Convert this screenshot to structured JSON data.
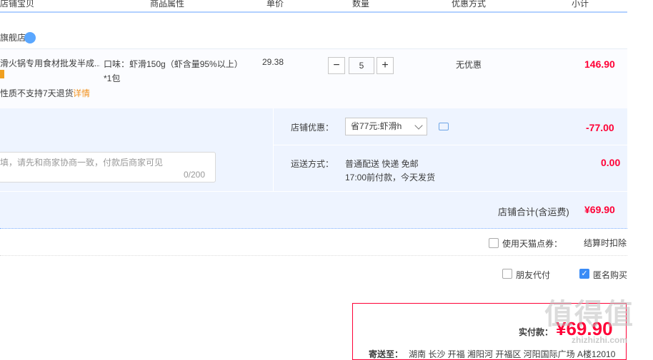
{
  "header": {
    "cols": [
      "店铺宝贝",
      "商品属性",
      "单价",
      "数量",
      "优惠方式",
      "小计"
    ]
  },
  "shop": {
    "name": "旗舰店"
  },
  "item": {
    "title": "滑火锅专用食材批发半成...",
    "attr": "口味：虾滑150g（虾含量95%以上）*1包",
    "notice": "性质不支持7天退货",
    "detail_link": "详情",
    "price": "29.38",
    "qty": "5",
    "minus": "−",
    "plus": "+",
    "promo": "无优惠",
    "subtotal": "146.90"
  },
  "order": {
    "shop_discount_label": "店铺优惠：",
    "shop_discount_select": "省77元:虾滑h",
    "shop_discount_value": "-77.00",
    "message_placeholder": "填，请先和商家协商一致，付款后商家可见",
    "message_count": "0/200",
    "shipping_label": "运送方式：",
    "shipping_method": "普通配送 快递 免邮",
    "shipping_note": "17:00前付款，今天发货",
    "shipping_value": "0.00",
    "shop_total_label": "店铺合计(含运费)",
    "shop_total_value": "¥69.90"
  },
  "options": {
    "tmall_points_label": "使用天猫点券：",
    "tmall_points_note": "结算时扣除",
    "friend_pay_label": "朋友代付",
    "anonymous_label": "匿名购买",
    "anonymous_checked": true
  },
  "payment": {
    "label": "实付款：",
    "value": "¥69.90",
    "ship_to_label": "寄送至：",
    "address": "湖南 长沙 开福 湘阳河 开福区 河阳国际广场 A楼12010"
  },
  "watermark": {
    "text": "值得值",
    "url": "zhizhizhi.com"
  },
  "colors": {
    "accent_red": "#ff0036",
    "border_blue": "#b2d1ff",
    "panel_blue": "#eef4ff",
    "link_orange": "#f2911d"
  }
}
